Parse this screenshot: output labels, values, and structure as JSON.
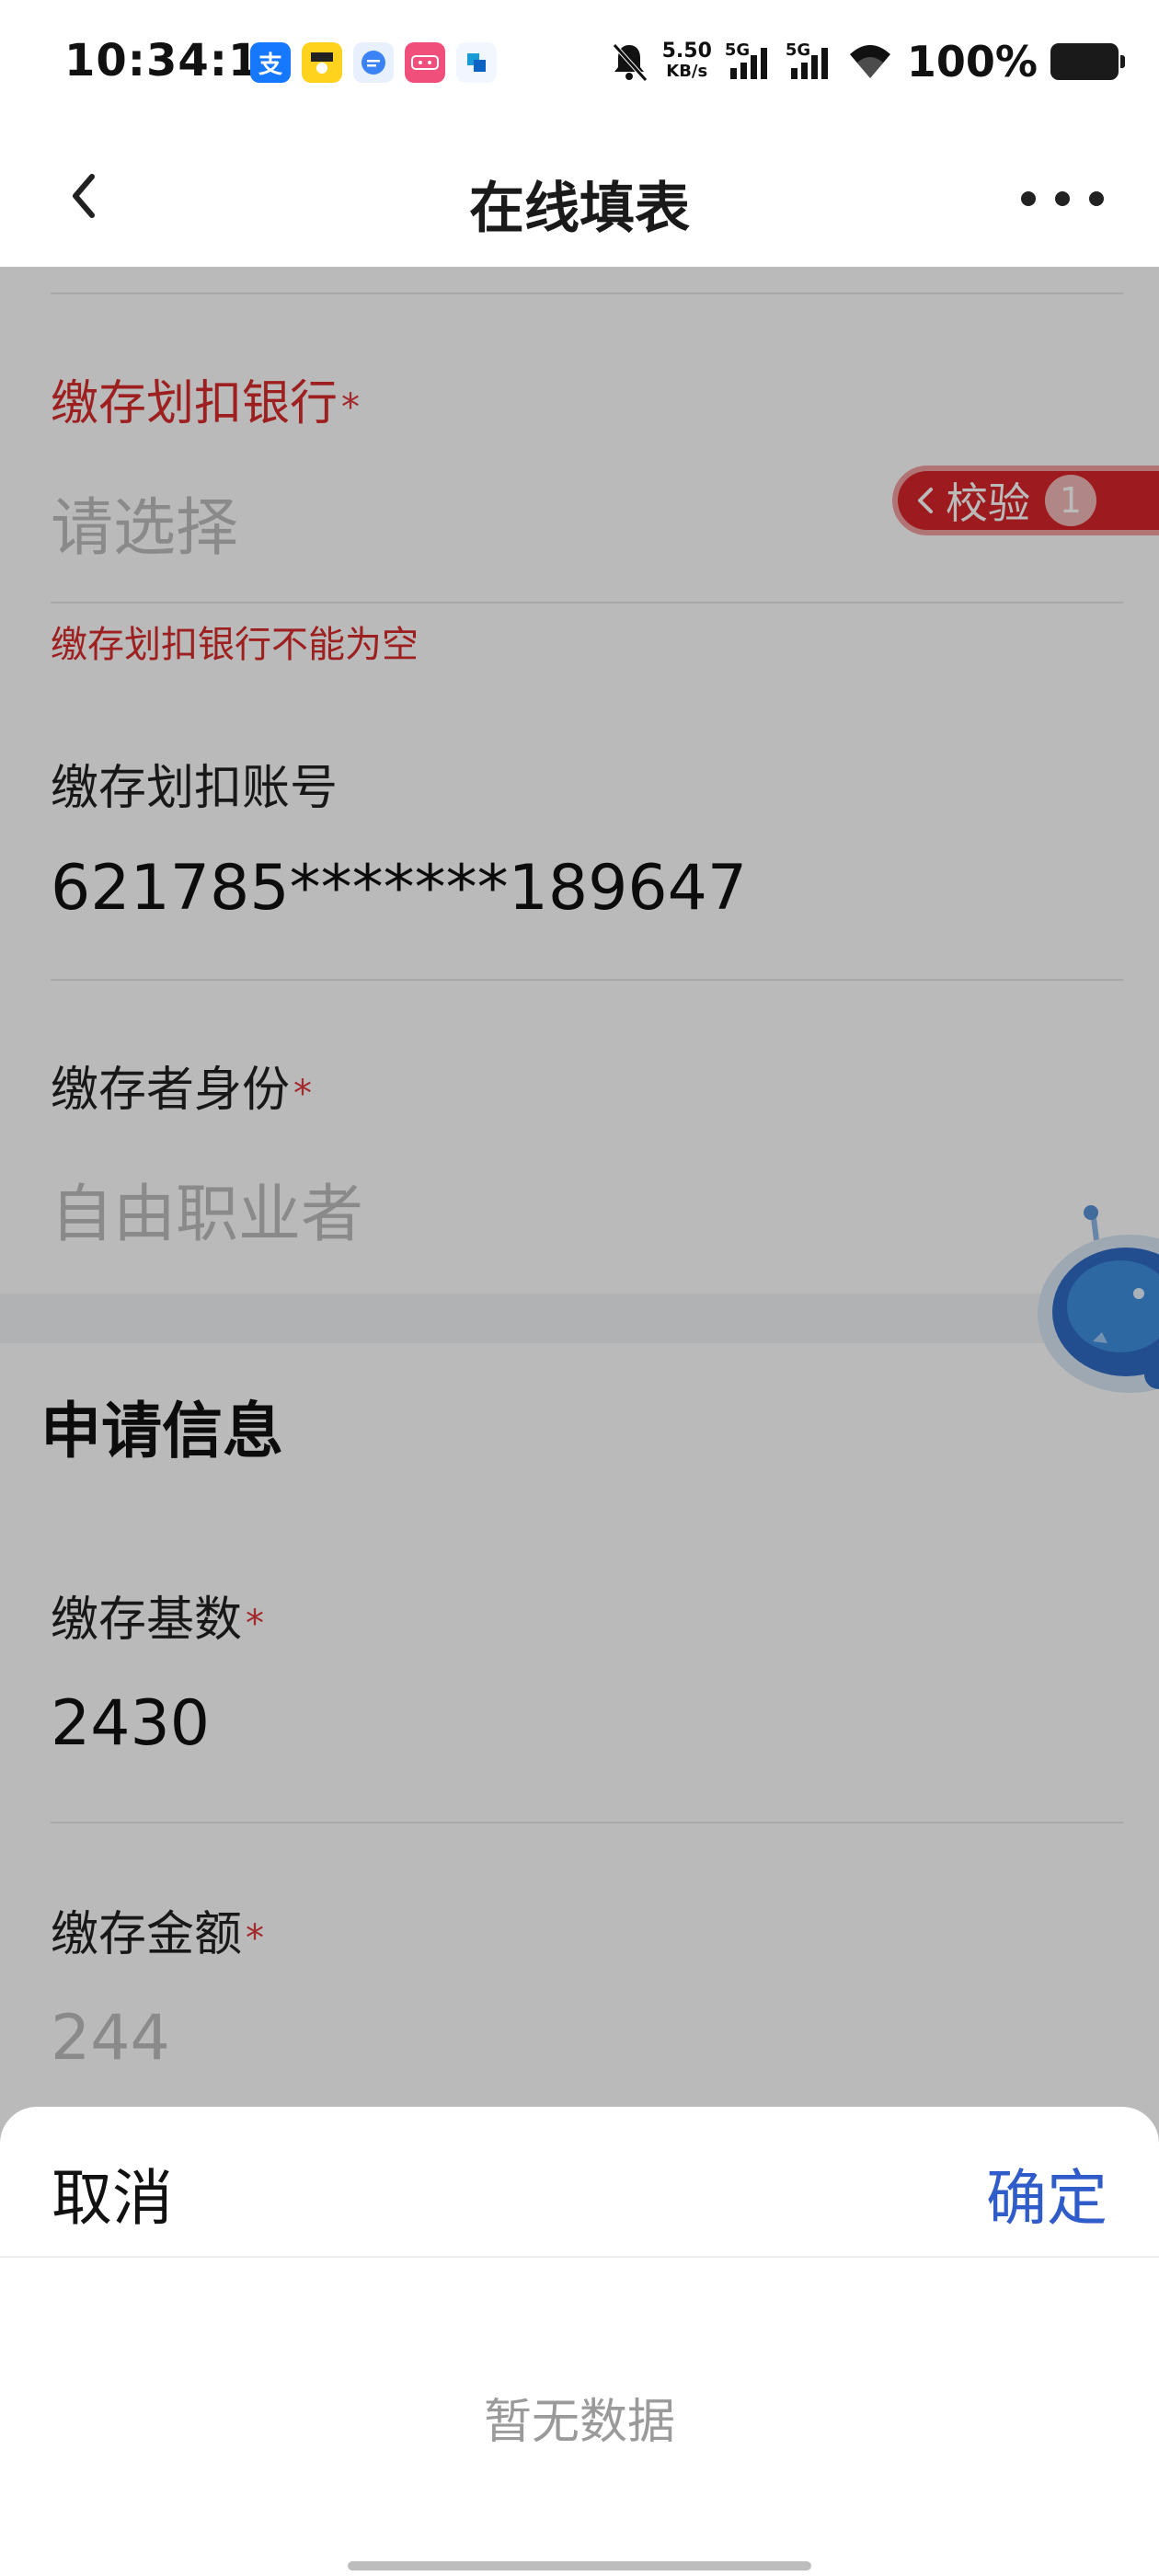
{
  "status_bar": {
    "time": "10:34:18",
    "net_speed_value": "5.50",
    "net_speed_unit": "KB/s",
    "signal_1": "5G",
    "signal_2": "5G",
    "battery_percent": "100%",
    "app_icons": [
      {
        "name": "alipay-icon",
        "glyph": "支",
        "color": "#1677ff"
      },
      {
        "name": "app-yellow-icon",
        "glyph": "",
        "color": "#ffd21e"
      },
      {
        "name": "app-chat-icon",
        "glyph": "",
        "color": "#3b82f6"
      },
      {
        "name": "app-pink-icon",
        "glyph": "",
        "color": "#ef4f7a"
      },
      {
        "name": "app-blue-icon",
        "glyph": "",
        "color": "#1a9ad6"
      }
    ]
  },
  "nav": {
    "title": "在线填表"
  },
  "form": {
    "bank_label": "缴存划扣银行",
    "bank_required": "*",
    "bank_placeholder": "请选择",
    "bank_error": "缴存划扣银行不能为空",
    "account_label": "缴存划扣账号",
    "account_value": "621785*******189647",
    "identity_label": "缴存者身份",
    "identity_required": "*",
    "identity_value": "自由职业者",
    "section_title": "申请信息",
    "base_label": "缴存基数",
    "base_required": "*",
    "base_value": "2430",
    "amount_label": "缴存金额",
    "amount_required": "*",
    "amount_value": "244"
  },
  "verify_tag": {
    "label": "校验",
    "count": "1"
  },
  "sheet": {
    "cancel": "取消",
    "confirm": "确定",
    "empty": "暂无数据"
  },
  "colors": {
    "error_red": "#d92b2b",
    "confirm_blue": "#2f5cc9",
    "verify_red": "#d8262a"
  }
}
